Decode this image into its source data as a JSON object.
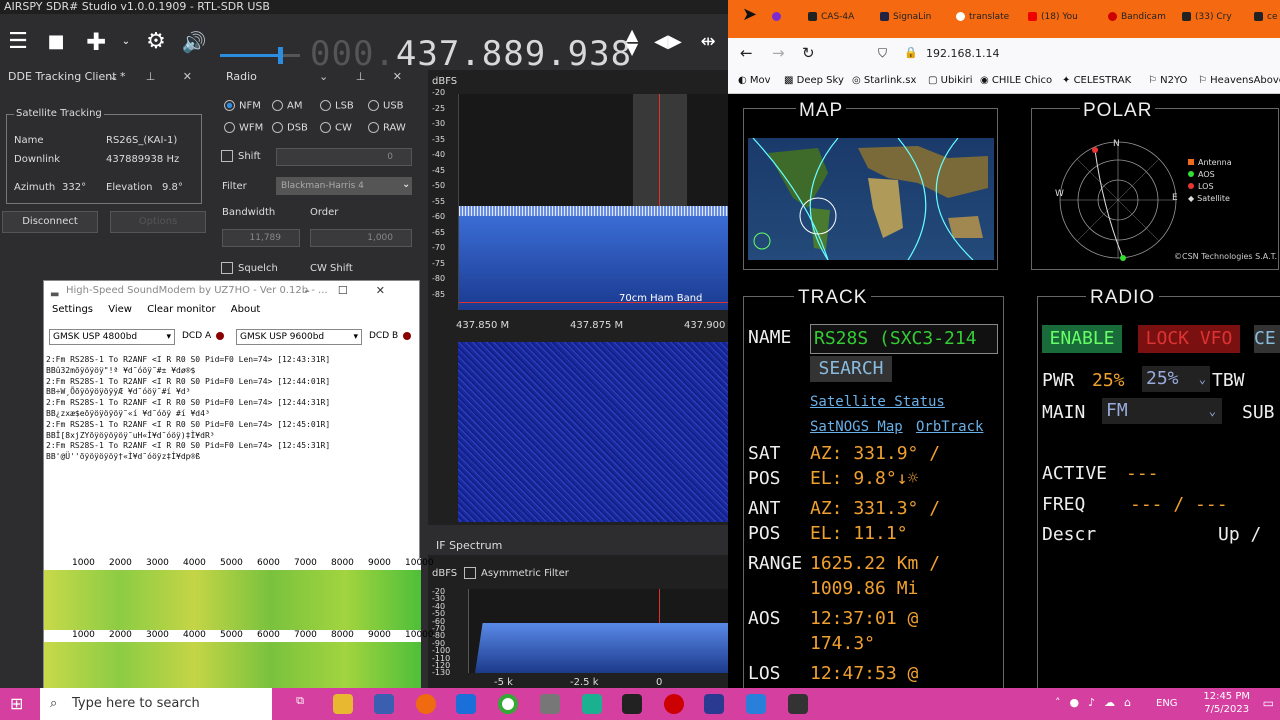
{
  "sdr": {
    "title": "AIRSPY SDR# Studio v1.0.0.1909 - RTL-SDR USB",
    "frequency_dim": "000.",
    "frequency": "437.889.938",
    "dde": {
      "header": "DDE Tracking Client *",
      "group": "Satellite Tracking",
      "name_label": "Name",
      "name_value": "RS26S_(KAI-1)",
      "downlink_label": "Downlink",
      "downlink_value": "437889938 Hz",
      "azimuth_label": "Azimuth",
      "azimuth_value": "332°",
      "elevation_label": "Elevation",
      "elevation_value": "9.8°",
      "disconnect": "Disconnect",
      "options": "Options"
    },
    "radio": {
      "header": "Radio",
      "modes": [
        "NFM",
        "AM",
        "LSB",
        "USB",
        "WFM",
        "DSB",
        "CW",
        "RAW"
      ],
      "selected_mode": "NFM",
      "shift_label": "Shift",
      "shift_value": "0",
      "filter_label": "Filter",
      "filter_value": "Blackman-Harris 4",
      "bandwidth_label": "Bandwidth",
      "bandwidth_value": "11,789",
      "order_label": "Order",
      "order_value": "1,000",
      "squelch_label": "Squelch",
      "cwshift_label": "CW Shift"
    },
    "spectrum": {
      "unit": "dBFS",
      "db_ticks": [
        "-20",
        "-25",
        "-30",
        "-35",
        "-40",
        "-45",
        "-50",
        "-55",
        "-60",
        "-65",
        "-70",
        "-75",
        "-80",
        "-85"
      ],
      "band_label": "70cm Ham Band",
      "freq_ticks": [
        "437.850 M",
        "437.875 M",
        "437.900 M"
      ]
    },
    "if_spectrum": {
      "header": "IF Spectrum",
      "unit": "dBFS",
      "asym_label": "Asymmetric Filter",
      "db_ticks": [
        "-20",
        "-30",
        "-40",
        "-50",
        "-60",
        "-70",
        "-80",
        "-90",
        "-100",
        "-110",
        "-120",
        "-130"
      ],
      "x_ticks": [
        "-5 k",
        "-2.5 k",
        "0"
      ]
    }
  },
  "soundmodem": {
    "title": "High-Speed SoundModem by UZ7HO - Ver 0.12b - ...",
    "menu": [
      "Settings",
      "View",
      "Clear monitor",
      "About"
    ],
    "modem_a": "GMSK USP 4800bd",
    "dcd_a": "DCD A",
    "modem_b": "GMSK USP 9600bd",
    "dcd_b": "DCD B",
    "log": [
      "2:Fm RS28S-1 To R2ANF <I R R0 S0 Pid=F0 Len=74> [12:43:31R]",
      "BBû32mõÿöÿöÿ\"!ª ¥d˜óöÿ˜#± ¥dø®$",
      "2:Fm RS28S-1 To R2ANF <I R R0 S0 Pid=F0 Len=74> [12:44:01R]",
      "BB÷W¸ÕõÿöÿöÿöÿÿÆ ¥d˜óöÿ˜#í ¥d³",
      "2:Fm RS28S-1 To R2ANF <I R R0 S0 Pid=F0 Len=74> [12:44:31R]",
      "BB¿zxæ$eõÿöÿöÿöÿ˜«í ¥d˜óöÿ #í ¥d4³",
      "2:Fm RS28S-1 To R2ANF <I R R0 S0 Pid=F0 Len=74> [12:45:01R]",
      "BBÎ[8xjZYõÿöÿöÿöÿ˜uH«Ì¥d˜óöÿ)‡Ì¥dR³",
      "2:Fm RS28S-1 To R2ANF <I R R0 S0 Pid=F0 Len=74> [12:45:31R]",
      "BB'@Ü''õÿöÿöÿöÿ†«Ì¥d˜óöÿz‡Ì¥dp®ß"
    ],
    "scale": [
      "1000",
      "2000",
      "3000",
      "4000",
      "5000",
      "6000",
      "7000",
      "8000",
      "9000",
      "10000"
    ]
  },
  "browser": {
    "tabs": [
      "CAS-4A",
      "SignaLin",
      "translate",
      "(18) You",
      "Bandicam",
      "(33) Cry",
      "ce"
    ],
    "url": "192.168.1.14",
    "bookmarks": [
      "Mov",
      "Deep Sky",
      "Starlink.sx",
      "Ubikiri",
      "CHILE Chico",
      "CELESTRAK",
      "N2YO",
      "HeavensAbove"
    ],
    "map_title": "MAP",
    "polar_title": "POLAR",
    "polar_legend": [
      "Antenna",
      "AOS",
      "LOS",
      "Satellite"
    ],
    "copyright": "©CSN Technologies S.A.T.",
    "track_title": "TRACK",
    "radio_title": "RADIO",
    "name_label": "NAME",
    "name_value": "RS28S (SXC3-214",
    "search_button": "SEARCH",
    "links": [
      "Satellite Status",
      "SatNOGS Map",
      "OrbTrack"
    ],
    "sat_label1": "SAT",
    "sat_label2": "POS",
    "sat_az": "AZ: 331.9° /",
    "sat_el": "EL: 9.8°↓☼",
    "ant_label1": "ANT",
    "ant_label2": "POS",
    "ant_az": "AZ: 331.3° /",
    "ant_el": "EL: 11.1°",
    "range_label": "RANGE",
    "range_km": "1625.22 Km /",
    "range_mi": "1009.86 Mi",
    "aos_label": "AOS",
    "aos_time": "12:37:01 @",
    "aos_az": "174.3°",
    "los_label": "LOS",
    "los_time": "12:47:53 @",
    "enable_button": "ENABLE",
    "lockvfo_button": "LOCK VFO",
    "ce_button": "CE",
    "pwr_label": "PWR",
    "pwr_value": "25%",
    "pwr_select": "25%",
    "tbw_label": "TBW",
    "main_label": "MAIN",
    "main_select": "FM",
    "sub_label": "SUB",
    "active_label": "ACTIVE",
    "active_value": "---",
    "freq_label": "FREQ",
    "freq_value": "--- / ---",
    "descr_label": "Descr",
    "updown_label": "Up /"
  },
  "taskbar": {
    "search_placeholder": "Type here to search",
    "lang": "ENG",
    "time": "12:45 PM",
    "date": "7/5/2023"
  },
  "colors": {
    "browser_tab_bar": "#f56a10",
    "taskbar": "#d43fa0",
    "value_orange": "#f0a030",
    "enable_green": "#1a6b3a",
    "lockvfo_red": "#7a1010"
  }
}
